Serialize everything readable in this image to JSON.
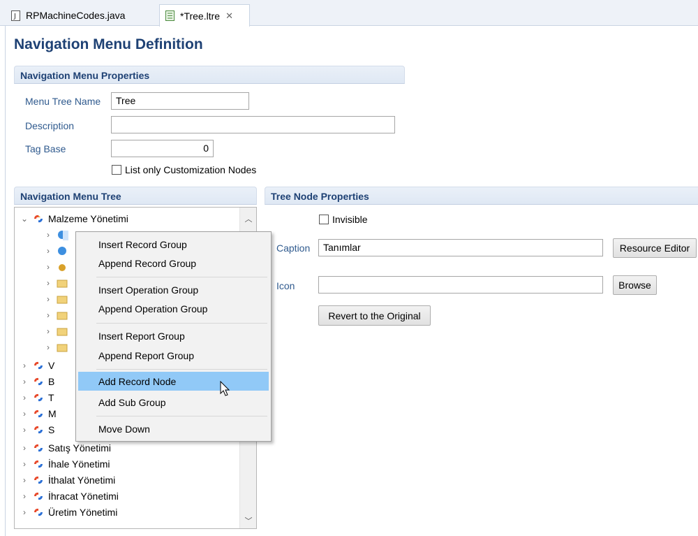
{
  "tabs": [
    {
      "label": "RPMachineCodes.java",
      "icon": "java-file-icon",
      "active": false
    },
    {
      "label": "*Tree.ltre",
      "icon": "tree-file-icon",
      "active": true,
      "close": "✕"
    }
  ],
  "page": {
    "title": "Navigation Menu Definition"
  },
  "properties": {
    "header": "Navigation Menu Properties",
    "menu_tree_name_label": "Menu Tree Name",
    "menu_tree_name_value": "Tree",
    "description_label": "Description",
    "description_value": "",
    "tag_base_label": "Tag Base",
    "tag_base_value": "0",
    "list_only_label": "List only Customization Nodes"
  },
  "tree": {
    "header": "Navigation Menu Tree",
    "root": "Malzeme Yönetimi",
    "partial_rows": [
      "V",
      "B",
      "T",
      "M",
      "S"
    ],
    "rows": [
      "Satış Yönetimi",
      "İhale Yönetimi",
      "İthalat Yönetimi",
      "İhracat Yönetimi",
      "Üretim Yönetimi"
    ]
  },
  "node_props": {
    "header": "Tree Node Properties",
    "invisible_label": "Invisible",
    "caption_label": "Caption",
    "caption_value": "Tanımlar",
    "resource_editor": "Resource Editor",
    "icon_label": "Icon",
    "icon_value": "",
    "browse": "Browse",
    "revert": "Revert to the Original"
  },
  "context_menu": {
    "items": [
      "Insert Record Group",
      "Append Record Group",
      "Insert Operation Group",
      "Append Operation Group",
      "Insert Report Group",
      "Append Report Group",
      "Add Record Node",
      "Add Sub Group",
      "Move Down"
    ],
    "highlighted": "Add Record Node"
  },
  "colors": {
    "heading": "#1e4174",
    "label": "#2f5a8e",
    "menu_highlight": "#91c9f7"
  }
}
